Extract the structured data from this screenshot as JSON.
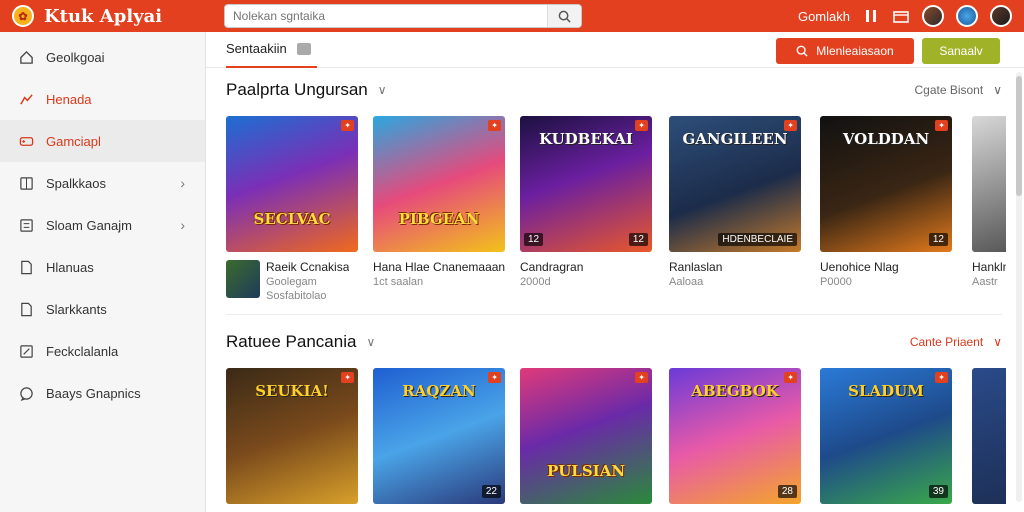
{
  "app": {
    "title": "Ktuk Aplyai"
  },
  "search": {
    "placeholder": "Nolekan sgntaika"
  },
  "topbar": {
    "link": "Gomlakh"
  },
  "sidebar": {
    "items": [
      {
        "label": "Geolkgoai",
        "icon": "home-icon"
      },
      {
        "label": "Henada",
        "icon": "trending-icon"
      },
      {
        "label": "Gamciapl",
        "icon": "gamepad-icon"
      },
      {
        "label": "Spalkkaos",
        "icon": "grid-icon"
      },
      {
        "label": "Sloam Ganajm",
        "icon": "list-icon"
      },
      {
        "label": "Hlanuas",
        "icon": "document-icon"
      },
      {
        "label": "Slarkkants",
        "icon": "document-icon"
      },
      {
        "label": "Feckclalanla",
        "icon": "edit-icon"
      },
      {
        "label": "Baays Gnapnics",
        "icon": "chat-icon"
      }
    ]
  },
  "subbar": {
    "tab_label": "Sentaakiin",
    "primary_button": "Mlenleaiasaon",
    "secondary_button": "Sanaalv"
  },
  "sections": [
    {
      "title": "Paalprta Ungursan",
      "more": "Cgate Bisont",
      "cards": [
        {
          "thumb_title": "SECLVAC",
          "title": "Raeik Ccnakisa",
          "sub": "Goolegam",
          "sub2": "Sosfabitolao",
          "badge": "",
          "left_badge": ""
        },
        {
          "thumb_title": "PIBGEAN",
          "title": "Hana Hlae Cnanemaaan",
          "sub": "1ct saalan",
          "badge": "",
          "left_badge": ""
        },
        {
          "thumb_title": "KUDBEKAI",
          "title": "Candragran",
          "sub": "2000d",
          "badge": "12",
          "left_badge": "12"
        },
        {
          "thumb_title": "GANGILEEN",
          "title": "Ranlaslan",
          "sub": "Aaloaa",
          "badge": "HDENBECLAIE",
          "left_badge": ""
        },
        {
          "thumb_title": "VOLDDAN",
          "title": "Uenohice Nlag",
          "sub": "P0000",
          "badge": "12",
          "left_badge": ""
        },
        {
          "thumb_title": "",
          "title": "Hankln",
          "sub": "Aastr",
          "badge": "",
          "left_badge": ""
        }
      ]
    },
    {
      "title": "Ratuee Pancania",
      "more": "Cante Priaent",
      "cards": [
        {
          "thumb_title": "SEUKIA!",
          "badge": "",
          "left_badge": ""
        },
        {
          "thumb_title": "RAQZAN",
          "badge": "22",
          "left_badge": ""
        },
        {
          "thumb_title": "PULSIAN",
          "badge": "",
          "left_badge": ""
        },
        {
          "thumb_title": "ABEGBOK",
          "badge": "28",
          "left_badge": ""
        },
        {
          "thumb_title": "SLADUM",
          "badge": "39",
          "left_badge": ""
        },
        {
          "thumb_title": "",
          "badge": "",
          "left_badge": ""
        }
      ]
    }
  ],
  "colors": {
    "brand": "#e2401f",
    "accent_green": "#9fb228"
  }
}
